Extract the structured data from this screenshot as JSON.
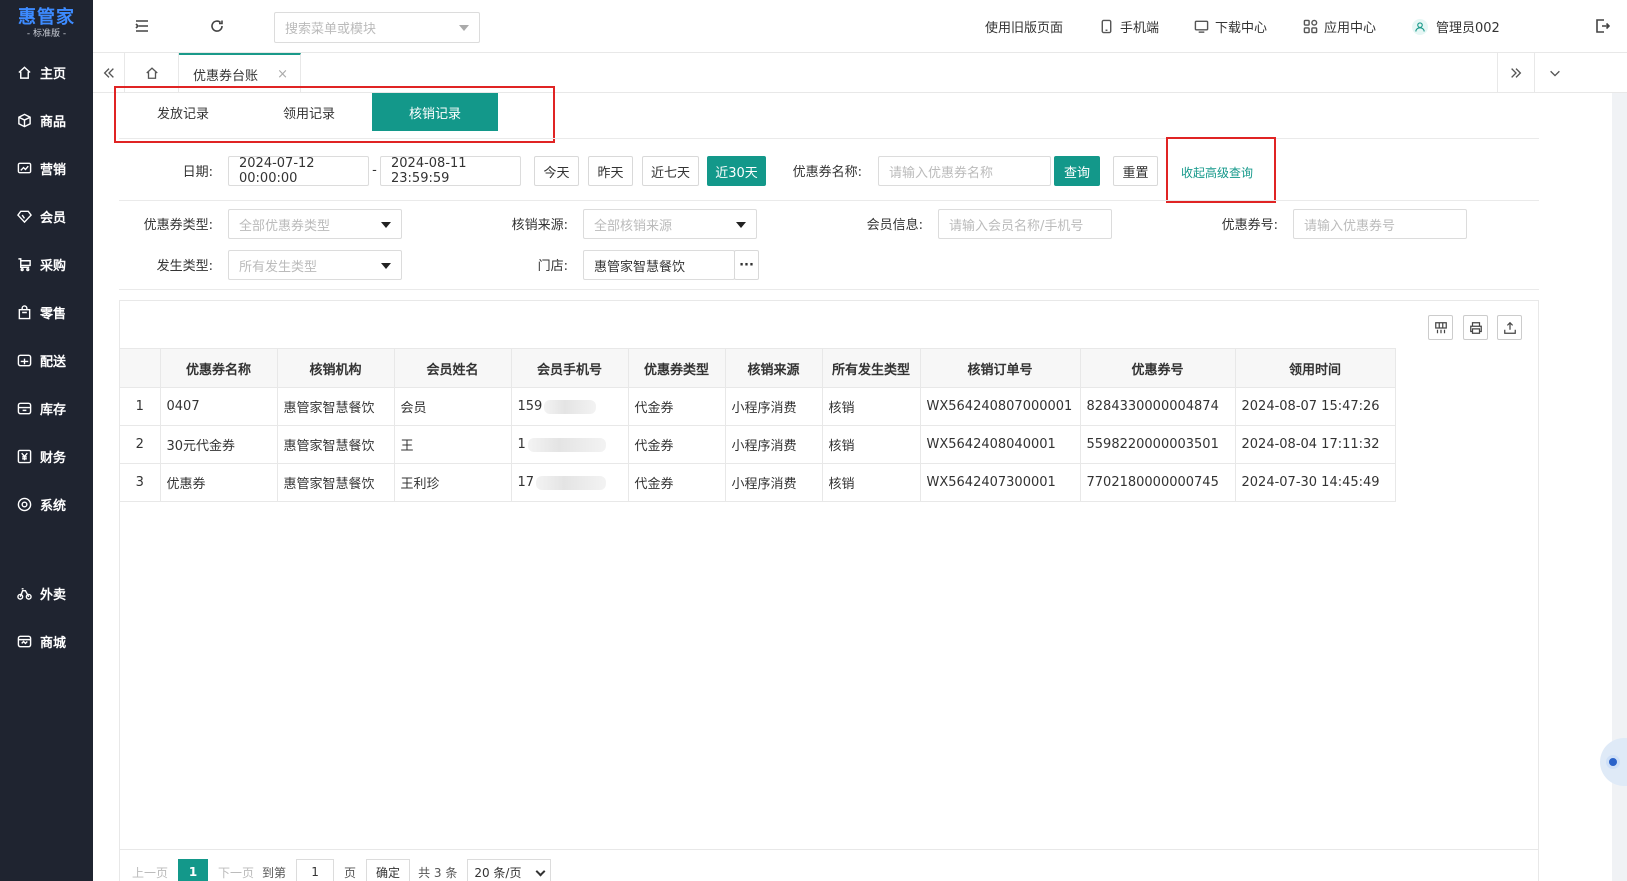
{
  "sidebar": {
    "logo_main": "惠管家",
    "logo_sub": "- 标准版 -",
    "items": [
      {
        "label": "主页",
        "icon": "home-icon"
      },
      {
        "label": "商品",
        "icon": "box-icon"
      },
      {
        "label": "营销",
        "icon": "chart-icon"
      },
      {
        "label": "会员",
        "icon": "diamond-icon"
      },
      {
        "label": "采购",
        "icon": "cart-icon"
      },
      {
        "label": "零售",
        "icon": "bag-icon"
      },
      {
        "label": "配送",
        "icon": "truck-icon"
      },
      {
        "label": "库存",
        "icon": "warehouse-icon"
      },
      {
        "label": "财务",
        "icon": "yuan-icon"
      },
      {
        "label": "系统",
        "icon": "settings-icon"
      },
      {
        "label": "外卖",
        "icon": "bike-icon"
      },
      {
        "label": "商城",
        "icon": "store-icon"
      }
    ]
  },
  "header": {
    "search_placeholder": "搜索菜单或模块",
    "old_version": "使用旧版页面",
    "mobile": "手机端",
    "download": "下载中心",
    "apps": "应用中心",
    "user": "管理员002"
  },
  "tabbar": {
    "current_tab": "优惠券台账",
    "close": "×"
  },
  "record_tabs": [
    "发放记录",
    "领用记录",
    "核销记录"
  ],
  "active_record_tab": 2,
  "filters": {
    "date_label": "日期:",
    "date_start": "2024-07-12 00:00:00",
    "date_sep": "-",
    "date_end": "2024-08-11 23:59:59",
    "quick_today": "今天",
    "quick_yesterday": "昨天",
    "quick_7": "近七天",
    "quick_30": "近30天",
    "coupon_name_label": "优惠券名称:",
    "coupon_name_placeholder": "请输入优惠券名称",
    "query": "查询",
    "reset": "重置",
    "collapse": "收起高级查询",
    "coupon_type_label": "优惠券类型:",
    "coupon_type_value": "全部优惠券类型",
    "source_label": "核销来源:",
    "source_value": "全部核销来源",
    "member_label": "会员信息:",
    "member_placeholder": "请输入会员名称/手机号",
    "coupon_no_label": "优惠券号:",
    "coupon_no_placeholder": "请输入优惠券号",
    "occur_label": "发生类型:",
    "occur_value": "所有发生类型",
    "store_label": "门店:",
    "store_value": "惠管家智慧餐饮",
    "store_more": "···"
  },
  "table": {
    "columns": [
      "",
      "优惠券名称",
      "核销机构",
      "会员姓名",
      "会员手机号",
      "优惠券类型",
      "核销来源",
      "所有发生类型",
      "核销订单号",
      "优惠券号",
      "领用时间"
    ],
    "rows": [
      [
        "1",
        "0407",
        "惠管家智慧餐饮",
        "会员",
        "159",
        "代金券",
        "小程序消费",
        "核销",
        "WX564240807000001",
        "8284330000004874",
        "2024-08-07 15:47:26"
      ],
      [
        "2",
        "30元代金券",
        "惠管家智慧餐饮",
        "王",
        "1",
        "代金券",
        "小程序消费",
        "核销",
        "WX5642408040001",
        "5598220000003501",
        "2024-08-04 17:11:32"
      ],
      [
        "3",
        "优惠券",
        "惠管家智慧餐饮",
        "王利珍",
        "17",
        "代金券",
        "小程序消费",
        "核销",
        "WX5642407300001",
        "7702180000000745",
        "2024-07-30 14:45:49"
      ]
    ]
  },
  "pager": {
    "prev": "上一页",
    "current": "1",
    "next": "下一页",
    "goto": "到第",
    "page_input": "1",
    "page_unit": "页",
    "confirm": "确定",
    "total": "共 3 条",
    "page_size": "20 条/页"
  },
  "colors": {
    "accent": "#13988a",
    "sidebar": "#1f2430",
    "highlight_box": "#e02424"
  }
}
